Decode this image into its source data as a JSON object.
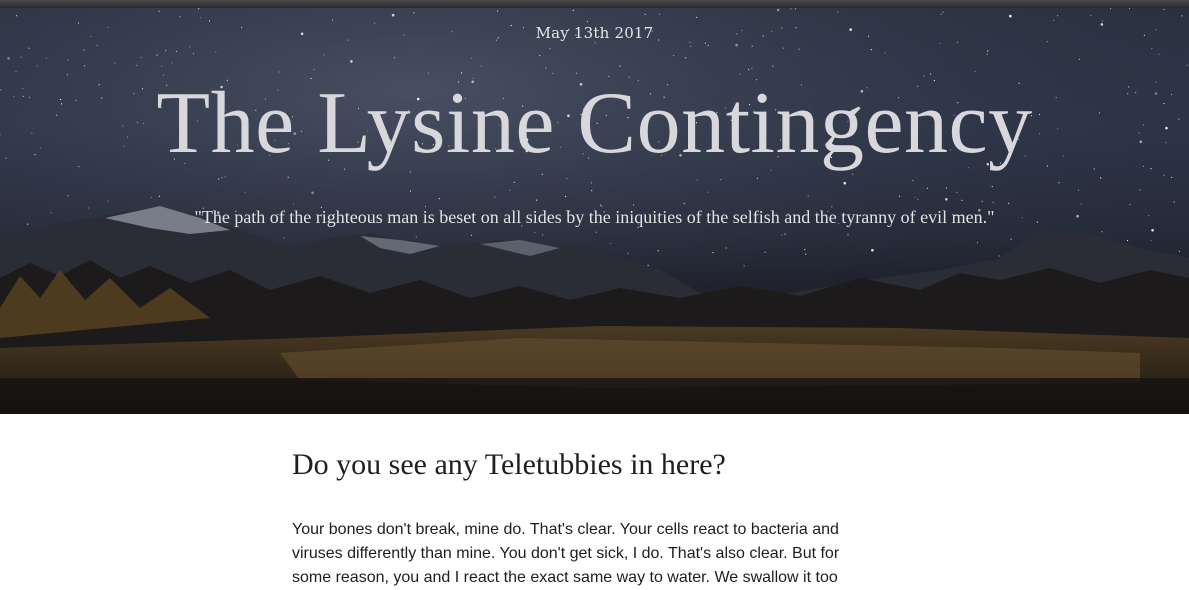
{
  "header": {
    "date": "May 13th 2017",
    "title": "The Lysine Contingency",
    "tagline": "\"The path of the righteous man is beset on all sides by the iniquities of the selfish and the tyranny of evil men.\""
  },
  "post": {
    "title": "Do you see any Teletubbies in here?",
    "body": "Your bones don't break, mine do. That's clear. Your cells react to bacteria and viruses differently than mine. You don't get sick, I do. That's also clear. But for some reason, you and I react the exact same way to water. We swallow it too"
  },
  "colors": {
    "topbar": "#333333",
    "sky": "#2c3446",
    "title_text": "#d7d7dc",
    "body_text": "#1e1e1e"
  }
}
